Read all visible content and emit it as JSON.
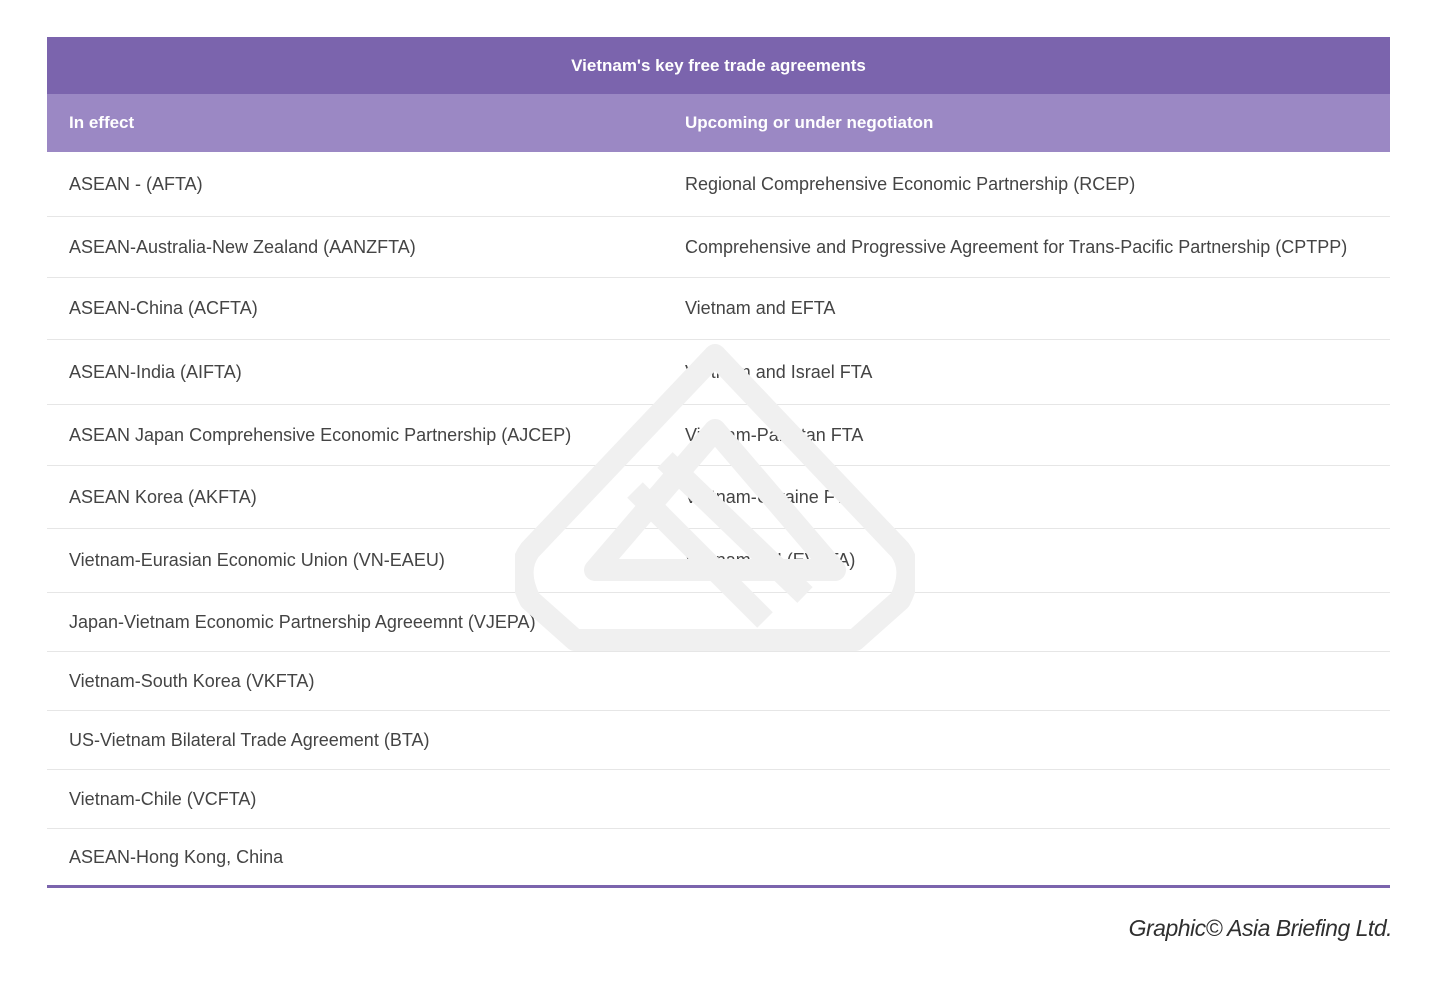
{
  "table": {
    "title": "Vietnam's key free trade agreements",
    "headers": [
      "In effect",
      "Upcoming or under negotiaton"
    ],
    "rows": [
      [
        "ASEAN - (AFTA)",
        "Regional Comprehensive Economic Partnership (RCEP)"
      ],
      [
        "ASEAN-Australia-New Zealand (AANZFTA)",
        "Comprehensive and Progressive Agreement for Trans-Pacific Partnership (CPTPP)"
      ],
      [
        "ASEAN-China (ACFTA)",
        "Vietnam and EFTA"
      ],
      [
        "ASEAN-India (AIFTA)",
        "Vietnam and Israel FTA"
      ],
      [
        "ASEAN Japan Comprehensive Economic Partnership (AJCEP)",
        "Vietnam-Pakistan FTA"
      ],
      [
        "ASEAN Korea (AKFTA)",
        "Vietnam-Ukraine FTA"
      ],
      [
        "Vietnam-Eurasian Economic Union (VN-EAEU)",
        "Vietnam-EU (EVFTA)"
      ],
      [
        "Japan-Vietnam Economic Partnership Agreeemnt (VJEPA)",
        ""
      ],
      [
        "Vietnam-South Korea (VKFTA)",
        ""
      ],
      [
        "US-Vietnam Bilateral Trade Agreement (BTA)",
        ""
      ],
      [
        "Vietnam-Chile (VCFTA)",
        ""
      ],
      [
        "ASEAN-Hong Kong, China",
        ""
      ]
    ]
  },
  "credit": "Graphic© Asia Briefing Ltd.",
  "colors": {
    "title_bg": "#7b64ad",
    "header_bg": "#9b88c4",
    "divider": "#e6e6e6",
    "bottom_rule": "#7b64ad"
  },
  "watermark": {
    "icon": "asia-briefing-logo-watermark"
  }
}
